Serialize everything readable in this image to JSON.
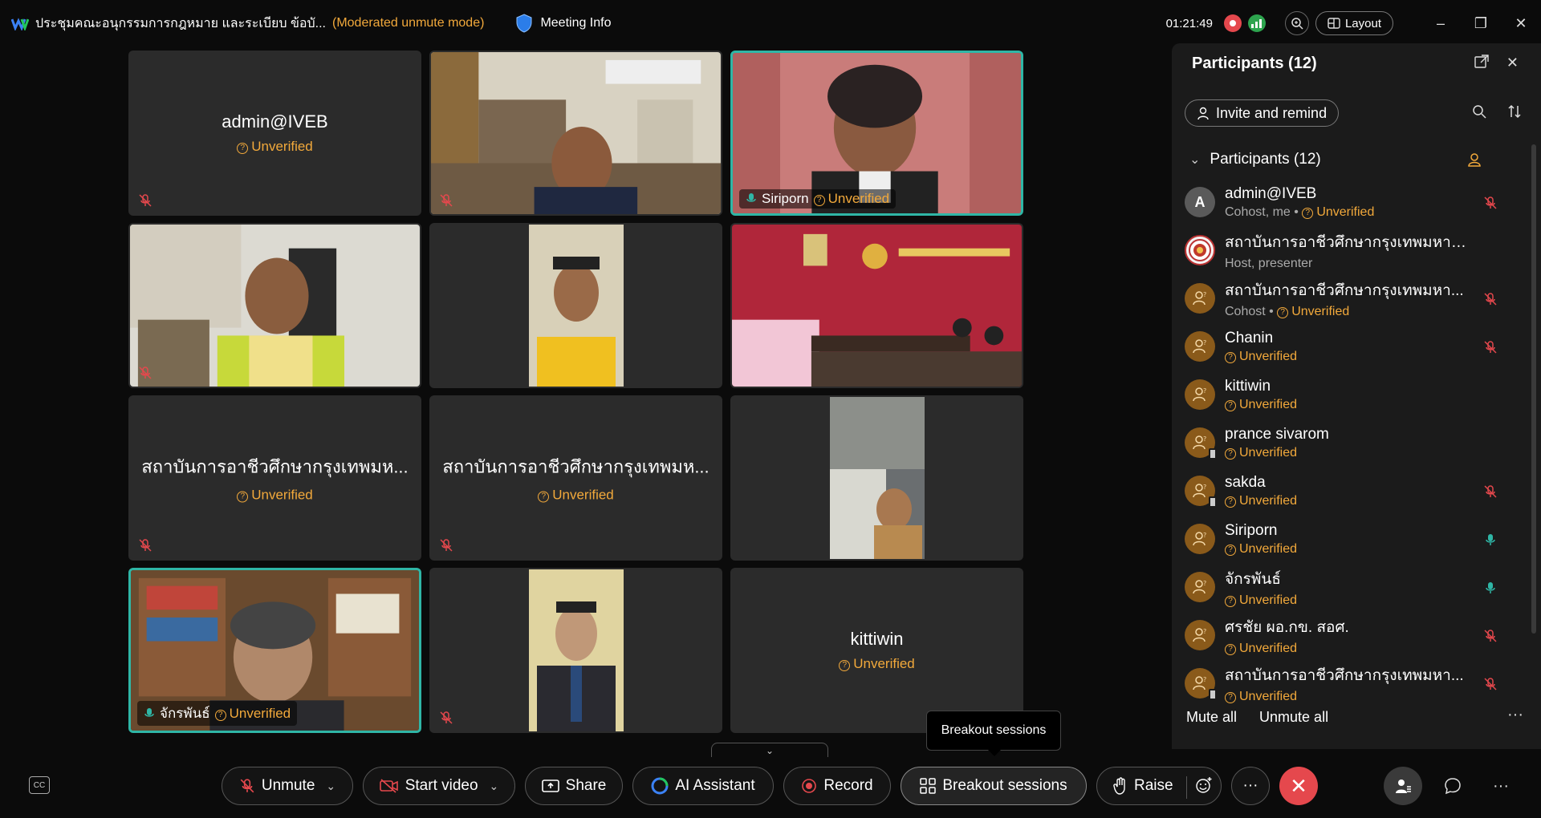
{
  "title_bar": {
    "meeting_title": "ประชุมคณะอนุกรรมการกฎหมาย และระเบียบ ข้อบั...",
    "mode": "(Moderated unmute mode)",
    "meeting_info": "Meeting Info",
    "timer": "01:21:49",
    "layout_label": "Layout"
  },
  "tiles": [
    {
      "name": "admin@IVEB",
      "status": "Unverified"
    },
    {
      "label": ""
    },
    {
      "label": "Siriporn",
      "status": "Unverified"
    },
    {
      "label": ""
    },
    {
      "label": ""
    },
    {
      "label": ""
    },
    {
      "name": "สถาบันการอาชีวศึกษากรุงเทพมห...",
      "status": "Unverified"
    },
    {
      "name": "สถาบันการอาชีวศึกษากรุงเทพมห...",
      "status": "Unverified"
    },
    {
      "label": ""
    },
    {
      "label": "จักรพันธ์",
      "status": "Unverified"
    },
    {
      "label": ""
    },
    {
      "name": "kittiwin",
      "status": "Unverified"
    }
  ],
  "tooltip": "Breakout sessions",
  "toolbar": {
    "unmute": "Unmute",
    "start_video": "Start video",
    "share": "Share",
    "ai_assistant": "AI Assistant",
    "record": "Record",
    "breakout": "Breakout sessions",
    "raise": "Raise"
  },
  "panel": {
    "title": "Participants (12)",
    "invite": "Invite and remind",
    "section": "Participants (12)",
    "participants": [
      {
        "name": "admin@IVEB",
        "role": "Cohost, me",
        "status": "Unverified",
        "avatar": "A"
      },
      {
        "name": "สถาบันการอาชีวศึกษากรุงเทพมหานคร",
        "role": "Host, presenter",
        "status": ""
      },
      {
        "name": "สถาบันการอาชีวศึกษากรุงเทพมหา...",
        "role": "Cohost",
        "status": "Unverified"
      },
      {
        "name": "Chanin",
        "role": "",
        "status": "Unverified"
      },
      {
        "name": "kittiwin",
        "role": "",
        "status": "Unverified"
      },
      {
        "name": "prance sivarom",
        "role": "",
        "status": "Unverified"
      },
      {
        "name": "sakda",
        "role": "",
        "status": "Unverified"
      },
      {
        "name": "Siriporn",
        "role": "",
        "status": "Unverified"
      },
      {
        "name": "จักรพันธ์",
        "role": "",
        "status": "Unverified"
      },
      {
        "name": "ศรชัย ผอ.กข. สอศ.",
        "role": "",
        "status": "Unverified"
      },
      {
        "name": "สถาบันการอาชีวศึกษากรุงเทพมหา...",
        "role": "",
        "status": "Unverified"
      }
    ],
    "mute_all": "Mute all",
    "unmute_all": "Unmute all"
  },
  "colors": {
    "accent_unverified": "#f2a93b",
    "active_border": "#2fb6a6",
    "end_red": "#e5484d"
  }
}
